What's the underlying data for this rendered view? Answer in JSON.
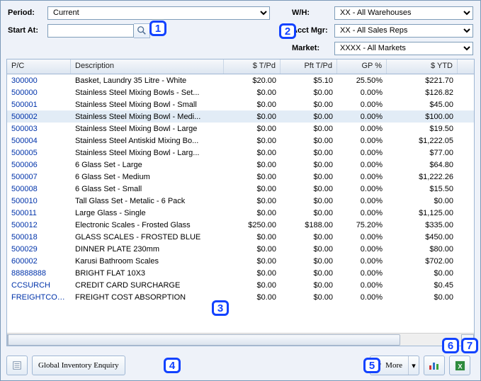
{
  "filters": {
    "period": {
      "label": "Period:",
      "value": "Current"
    },
    "startAt": {
      "label": "Start At:",
      "value": ""
    },
    "wh": {
      "label": "W/H:",
      "value": "XX - All Warehouses"
    },
    "acctMgr": {
      "label": "Acct Mgr:",
      "value": "XX - All Sales Reps"
    },
    "market": {
      "label": "Market:",
      "value": "XXXX - All Markets"
    }
  },
  "markers": [
    "1",
    "2",
    "3",
    "4",
    "5",
    "6",
    "7"
  ],
  "grid": {
    "columns": [
      "P/C",
      "Description",
      "$ T/Pd",
      "Pft T/Pd",
      "GP %",
      "$ YTD"
    ],
    "selectedIndex": 3,
    "rows": [
      {
        "pc": "300000",
        "desc": "Basket, Laundry 35 Litre - White",
        "tpd": "$20.00",
        "pft": "$5.10",
        "gp": "25.50%",
        "ytd": "$221.70"
      },
      {
        "pc": "500000",
        "desc": "Stainless Steel Mixing Bowls - Set...",
        "tpd": "$0.00",
        "pft": "$0.00",
        "gp": "0.00%",
        "ytd": "$126.82"
      },
      {
        "pc": "500001",
        "desc": "Stainless Steel Mixing Bowl - Small",
        "tpd": "$0.00",
        "pft": "$0.00",
        "gp": "0.00%",
        "ytd": "$45.00"
      },
      {
        "pc": "500002",
        "desc": "Stainless Steel Mixing Bowl - Medi...",
        "tpd": "$0.00",
        "pft": "$0.00",
        "gp": "0.00%",
        "ytd": "$100.00"
      },
      {
        "pc": "500003",
        "desc": "Stainless Steel Mixing Bowl - Large",
        "tpd": "$0.00",
        "pft": "$0.00",
        "gp": "0.00%",
        "ytd": "$19.50"
      },
      {
        "pc": "500004",
        "desc": "Stainless Steel Antiskid Mixing Bo...",
        "tpd": "$0.00",
        "pft": "$0.00",
        "gp": "0.00%",
        "ytd": "$1,222.05"
      },
      {
        "pc": "500005",
        "desc": "Stainless Steel Mixing Bowl - Larg...",
        "tpd": "$0.00",
        "pft": "$0.00",
        "gp": "0.00%",
        "ytd": "$77.00"
      },
      {
        "pc": "500006",
        "desc": "6 Glass Set - Large",
        "tpd": "$0.00",
        "pft": "$0.00",
        "gp": "0.00%",
        "ytd": "$64.80"
      },
      {
        "pc": "500007",
        "desc": "6 Glass Set - Medium",
        "tpd": "$0.00",
        "pft": "$0.00",
        "gp": "0.00%",
        "ytd": "$1,222.26"
      },
      {
        "pc": "500008",
        "desc": "6 Glass Set - Small",
        "tpd": "$0.00",
        "pft": "$0.00",
        "gp": "0.00%",
        "ytd": "$15.50"
      },
      {
        "pc": "500010",
        "desc": "Tall Glass Set - Metalic - 6 Pack",
        "tpd": "$0.00",
        "pft": "$0.00",
        "gp": "0.00%",
        "ytd": "$0.00"
      },
      {
        "pc": "500011",
        "desc": "Large Glass - Single",
        "tpd": "$0.00",
        "pft": "$0.00",
        "gp": "0.00%",
        "ytd": "$1,125.00"
      },
      {
        "pc": "500012",
        "desc": "Electronic Scales - Frosted Glass",
        "tpd": "$250.00",
        "pft": "$188.00",
        "gp": "75.20%",
        "ytd": "$335.00"
      },
      {
        "pc": "500018",
        "desc": "GLASS SCALES - FROSTED BLUE",
        "tpd": "$0.00",
        "pft": "$0.00",
        "gp": "0.00%",
        "ytd": "$450.00"
      },
      {
        "pc": "500029",
        "desc": "DINNER PLATE 230mm",
        "tpd": "$0.00",
        "pft": "$0.00",
        "gp": "0.00%",
        "ytd": "$80.00"
      },
      {
        "pc": "600002",
        "desc": "Karusi Bathroom Scales",
        "tpd": "$0.00",
        "pft": "$0.00",
        "gp": "0.00%",
        "ytd": "$702.00"
      },
      {
        "pc": "88888888",
        "desc": "BRIGHT FLAT 10X3",
        "tpd": "$0.00",
        "pft": "$0.00",
        "gp": "0.00%",
        "ytd": "$0.00"
      },
      {
        "pc": "CCSURCH",
        "desc": "CREDIT CARD SURCHARGE",
        "tpd": "$0.00",
        "pft": "$0.00",
        "gp": "0.00%",
        "ytd": "$0.45"
      },
      {
        "pc": "FREIGHTCOST",
        "desc": "FREIGHT COST ABSORPTION",
        "tpd": "$0.00",
        "pft": "$0.00",
        "gp": "0.00%",
        "ytd": "$0.00"
      }
    ]
  },
  "footer": {
    "globalEnquiry": "Global Inventory Enquiry",
    "more": "More"
  }
}
